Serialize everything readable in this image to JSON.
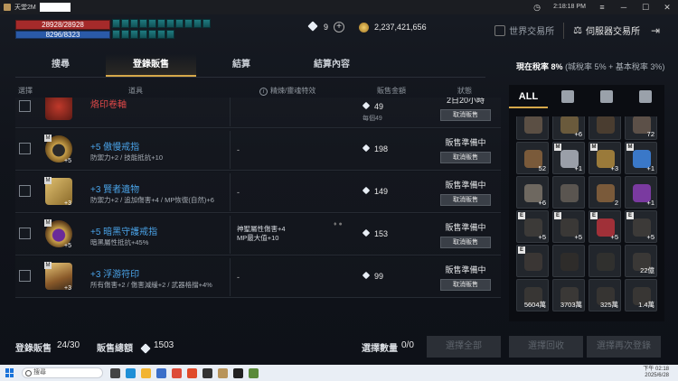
{
  "window": {
    "app_title": "天堂2M",
    "time": "2:18:18 PM"
  },
  "player": {
    "hp": "28928/28928",
    "mp": "8296/8323"
  },
  "currency": {
    "diamonds": "9",
    "gold": "2,237,421,656"
  },
  "top_right": {
    "world_exchange": "世界交易所",
    "server_exchange": "伺服器交易所"
  },
  "tabs": [
    {
      "label": "搜尋"
    },
    {
      "label": "登錄販售"
    },
    {
      "label": "結算"
    },
    {
      "label": "結算內容"
    }
  ],
  "tax": {
    "label": "現在稅率",
    "value": "8%",
    "detail": "(城稅率 5% + 基本稅率 3%)"
  },
  "table": {
    "headers": {
      "select": "選擇",
      "item": "道具",
      "special": "精煉/靈魂特效",
      "price": "販售金額",
      "status": "狀態"
    },
    "cancel_label": "取消販售",
    "rows": [
      {
        "name": "烙印卷軸",
        "enh": "",
        "desc": "",
        "special": "",
        "special2": "",
        "price": "49",
        "unit": "每個49",
        "status": "2日20小時"
      },
      {
        "name": "+5 傲慢戒指",
        "enh": "+5",
        "desc": "防禦力+2 / 技能抵抗+10",
        "special": "-",
        "special2": "",
        "price": "198",
        "unit": "",
        "status": "販售準備中"
      },
      {
        "name": "+3 賢者遺物",
        "enh": "+3",
        "desc": "防禦力+2 / 追加傷害+4 / MP恢復(自然)+6",
        "special": "-",
        "special2": "",
        "price": "149",
        "unit": "",
        "status": "販售準備中"
      },
      {
        "name": "+5 暗黑守護戒指",
        "enh": "+5",
        "desc": "暗黑屬性抵抗+45%",
        "special": "神聖屬性傷害+4",
        "special2": "MP最大值+10",
        "price": "153",
        "unit": "",
        "status": "販售準備中"
      },
      {
        "name": "+3 浮游符印",
        "enh": "+3",
        "desc": "所有傷害+2 / 傷害減緩+2 / 武器格擋+4%",
        "special": "-",
        "special2": "",
        "price": "99",
        "unit": "",
        "status": "販售準備中"
      }
    ]
  },
  "inventory": {
    "tab_all": "ALL",
    "slots": [
      {
        "count": "",
        "tag": "",
        "color": "#5b4f44"
      },
      {
        "count": "+6",
        "tag": "",
        "color": "#6a5a3c"
      },
      {
        "count": "",
        "tag": "",
        "color": "#4a3d30"
      },
      {
        "count": "72",
        "tag": "",
        "color": "#5c5048"
      },
      {
        "count": "52",
        "tag": "",
        "color": "#7a5a3a"
      },
      {
        "count": "+1",
        "tag": "M",
        "color": "#9a9fa8"
      },
      {
        "count": "+3",
        "tag": "M",
        "color": "#9a7a3a"
      },
      {
        "count": "+1",
        "tag": "M",
        "color": "#3a78c8"
      },
      {
        "count": "+6",
        "tag": "",
        "color": "#6e6860"
      },
      {
        "count": "",
        "tag": "",
        "color": "#5a5550"
      },
      {
        "count": "2",
        "tag": "",
        "color": "#7a5a3a"
      },
      {
        "count": "+1",
        "tag": "",
        "color": "#7a3aa0"
      },
      {
        "count": "+5",
        "tag": "E",
        "color": "#3c3a38"
      },
      {
        "count": "+5",
        "tag": "E",
        "color": "#3a3836"
      },
      {
        "count": "+5",
        "tag": "E",
        "color": "#a03038"
      },
      {
        "count": "+5",
        "tag": "E",
        "color": "#3c3a38"
      },
      {
        "count": "",
        "tag": "E",
        "color": "#3a3634"
      },
      {
        "count": "",
        "tag": "",
        "color": "#2e2c2a"
      },
      {
        "count": "",
        "tag": "",
        "color": "#30302e"
      },
      {
        "count": "22億",
        "tag": "",
        "color": "#3a3836"
      },
      {
        "count": "5604萬",
        "tag": "",
        "color": "#383634"
      },
      {
        "count": "3703萬",
        "tag": "",
        "color": "#3a3836"
      },
      {
        "count": "325萬",
        "tag": "",
        "color": "#363432"
      },
      {
        "count": "1.4萬",
        "tag": "",
        "color": "#383634"
      }
    ]
  },
  "footer": {
    "listing_label": "登錄販售",
    "listing_count": "24/30",
    "total_label": "販售總額",
    "total_value": "1503",
    "selected_label": "選擇數量",
    "selected_value": "0/0",
    "btn_select_all": "選擇全部",
    "btn_reclaim": "選擇回收",
    "btn_relist": "選擇再次登錄"
  },
  "taskbar": {
    "search_placeholder": "搜尋",
    "clock_time": "下午 02:18",
    "clock_date": "2025/6/28"
  }
}
